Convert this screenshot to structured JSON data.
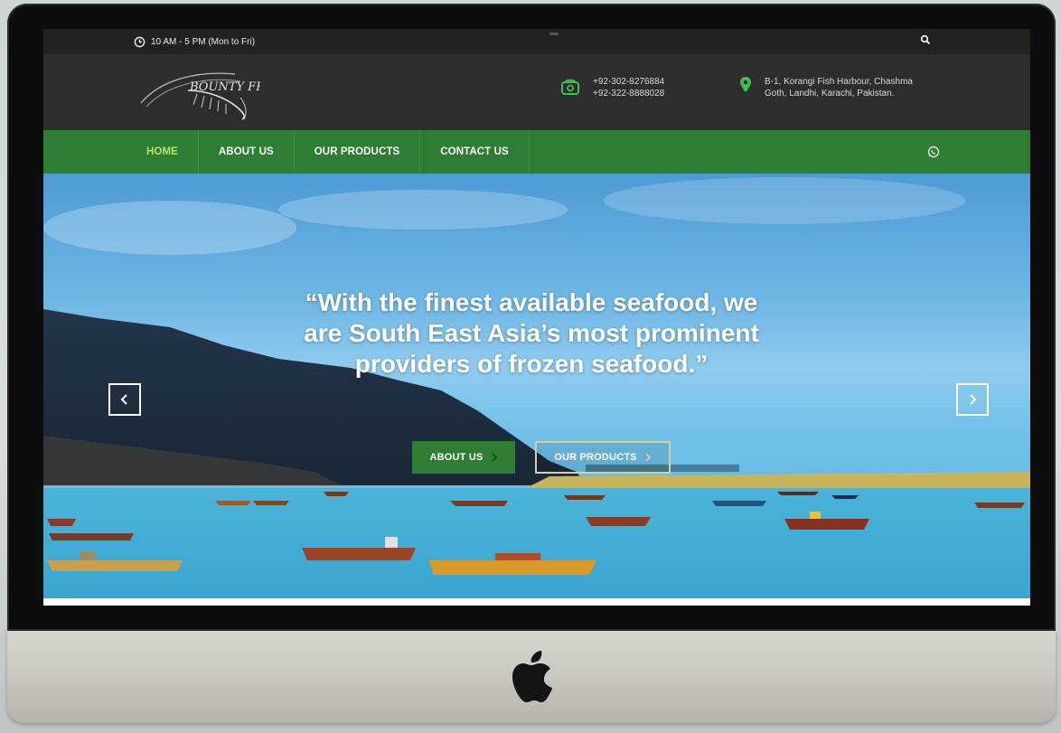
{
  "topbar": {
    "hours": "10 AM - 5 PM (Mon to Fri)",
    "icons": {
      "clock": "clock-icon",
      "search": "search-icon"
    }
  },
  "header": {
    "logo_text": "BOUNTY FRESH",
    "phone": [
      "+92-302-8276884",
      "+92-322-8888028"
    ],
    "address": [
      "B-1, Korangi Fish Harbour, Chashma",
      "Goth, Landhi, Karachi, Pakistan."
    ],
    "icons": {
      "phone": "phone-icon",
      "address": "map-pin-icon"
    }
  },
  "nav": {
    "items": [
      {
        "label": "HOME",
        "active": true
      },
      {
        "label": "ABOUT US",
        "active": false
      },
      {
        "label": "OUR PRODUCTS",
        "active": false
      },
      {
        "label": "CONTACT US",
        "active": false
      }
    ],
    "whatsapp_icon": "whatsapp-icon"
  },
  "hero": {
    "headline": "“With the finest available seafood, we are South East Asia’s most prominent providers of frozen seafood.”",
    "buttons": {
      "about": "ABOUT US",
      "products": "OUR PRODUCTS"
    },
    "prev_icon": "chevron-left-icon",
    "next_icon": "chevron-right-icon"
  },
  "colors": {
    "nav_green": "#2e7d32",
    "active_nav": "#b6e36a",
    "header_dark": "#2d2d2d",
    "topbar_dark": "#1f241f",
    "accent_green": "#3fbf4f"
  }
}
